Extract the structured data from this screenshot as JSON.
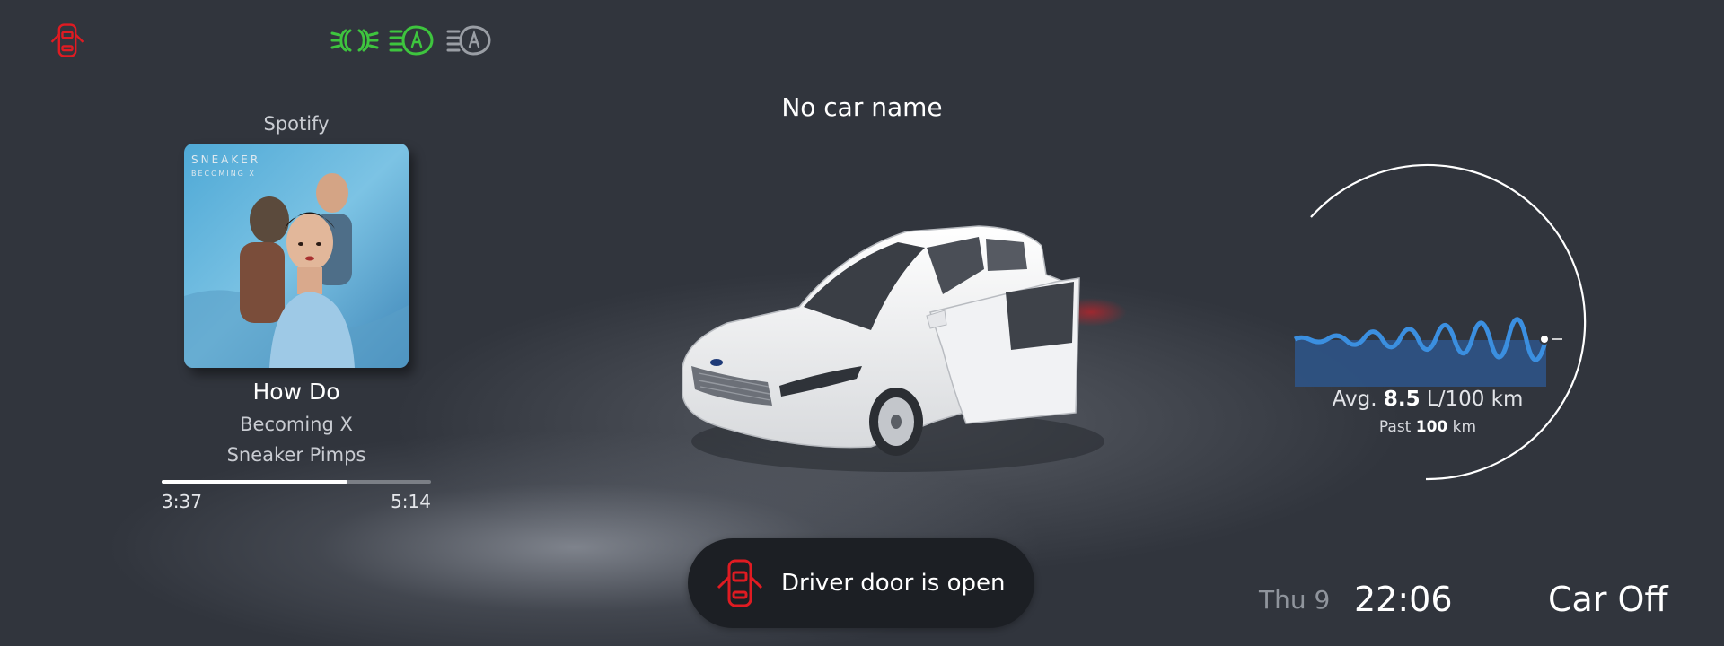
{
  "colors": {
    "background": "#31353d",
    "alert_red": "#e01b22",
    "indicator_green": "#3ec53e",
    "indicator_gray": "#9a9ea5",
    "graph_blue": "#3b8fe0"
  },
  "status_icons": [
    {
      "name": "door-open-icon",
      "color": "#e01b22"
    },
    {
      "name": "headlights-icon",
      "color": "#3ec53e"
    },
    {
      "name": "auto-high-beam-icon",
      "color": "#3ec53e",
      "letter": "A"
    },
    {
      "name": "auto-headlights-icon",
      "color": "#9a9ea5",
      "letter": "A"
    }
  ],
  "media": {
    "source": "Spotify",
    "title": "How Do",
    "album": "Becoming X",
    "artist": "Sneaker Pimps",
    "elapsed": "3:37",
    "duration": "5:14",
    "progress_fraction": 0.69,
    "album_art_text_1": "SNEAKER",
    "album_art_text_2": "BECOMING X"
  },
  "car": {
    "name": "No car name",
    "state": "Car Off"
  },
  "efficiency": {
    "avg_label": "Avg.",
    "avg_value": "8.5",
    "avg_unit": "L/100 km",
    "past_label": "Past",
    "past_value": "100",
    "past_unit": "km"
  },
  "alert": {
    "message": "Driver door is open",
    "icon": "door-open-icon"
  },
  "clock": {
    "date": "Thu 9",
    "time": "22:06"
  }
}
